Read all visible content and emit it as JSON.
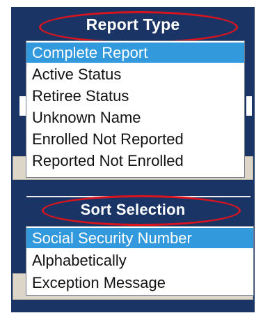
{
  "report_type": {
    "title": "Report Type",
    "items": [
      {
        "label": "Complete Report",
        "selected": true
      },
      {
        "label": "Active Status",
        "selected": false
      },
      {
        "label": "Retiree Status",
        "selected": false
      },
      {
        "label": "Unknown Name",
        "selected": false
      },
      {
        "label": "Enrolled Not Reported",
        "selected": false
      },
      {
        "label": "Reported Not Enrolled",
        "selected": false
      }
    ]
  },
  "sort_selection": {
    "title": "Sort Selection",
    "items": [
      {
        "label": "Social Security Number",
        "selected": true
      },
      {
        "label": "Alphabetically",
        "selected": false
      },
      {
        "label": "Exception Message",
        "selected": false
      }
    ]
  },
  "colors": {
    "panel_background": "#1a3565",
    "selection_highlight": "#3399dd",
    "annotation_ellipse": "#d9141e"
  }
}
